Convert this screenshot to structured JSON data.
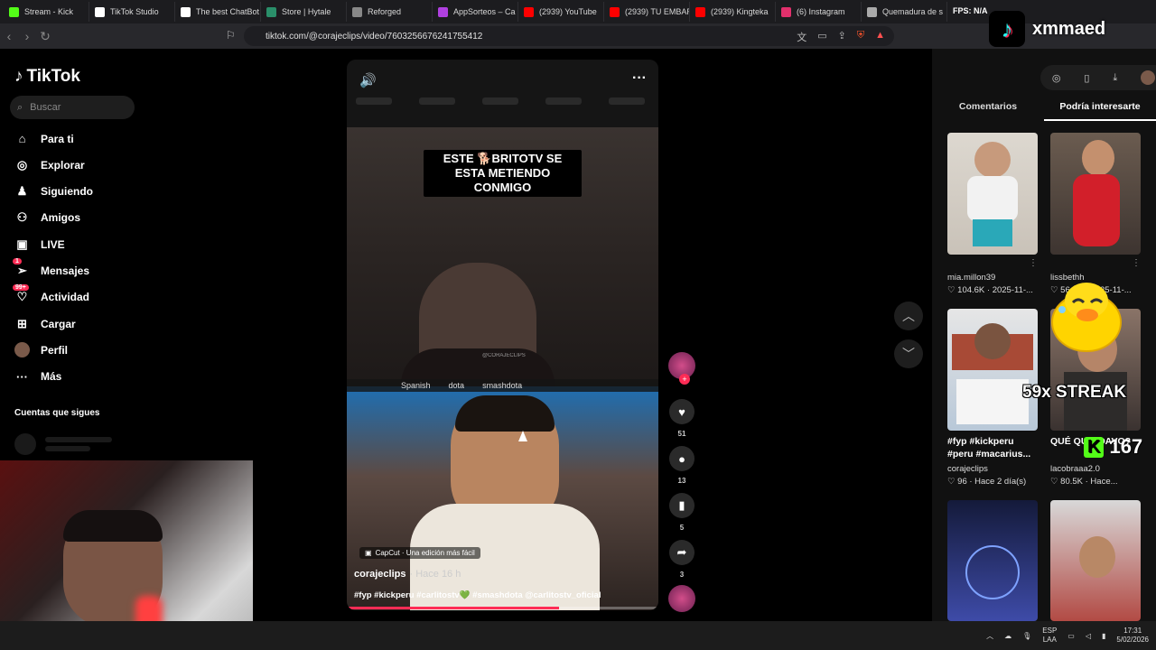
{
  "browser": {
    "tabs": [
      {
        "title": "Stream - Kick",
        "color": "#53fc18"
      },
      {
        "title": "TikTok Studio",
        "color": "#ffffff"
      },
      {
        "title": "The best ChatBot",
        "color": "#ffffff"
      },
      {
        "title": "Store | Hytale",
        "color": "#2a8f6a"
      },
      {
        "title": "Reforged",
        "color": "#888888"
      },
      {
        "title": "AppSorteos – Ca",
        "color": "#b040e0"
      },
      {
        "title": "(2939) YouTube",
        "color": "#ff0000"
      },
      {
        "title": "(2939) TU EMBAR",
        "color": "#ff0000"
      },
      {
        "title": "(2939) Kingteka",
        "color": "#ff0000"
      },
      {
        "title": "(6) Instagram",
        "color": "#e1306c"
      },
      {
        "title": "Quemadura de s",
        "color": "#aaaaaa"
      }
    ],
    "url": "tiktok.com/@corajeclips/video/7603256676241755412",
    "overlay_text": "FPS: N/A"
  },
  "sidebar": {
    "logo": "TikTok",
    "search_placeholder": "Buscar",
    "items": [
      {
        "label": "Para ti",
        "icon": "home-icon",
        "glyph": "⌂"
      },
      {
        "label": "Explorar",
        "icon": "compass-icon",
        "glyph": "◎"
      },
      {
        "label": "Siguiendo",
        "icon": "following-icon",
        "glyph": "♟"
      },
      {
        "label": "Amigos",
        "icon": "friends-icon",
        "glyph": "⚇"
      },
      {
        "label": "LIVE",
        "icon": "live-icon",
        "glyph": "▣"
      },
      {
        "label": "Mensajes",
        "icon": "messages-icon",
        "glyph": "➢",
        "badge": "1"
      },
      {
        "label": "Actividad",
        "icon": "activity-icon",
        "glyph": "♡",
        "badge": "99+"
      },
      {
        "label": "Cargar",
        "icon": "upload-icon",
        "glyph": "⊞"
      },
      {
        "label": "Perfil",
        "icon": "profile-icon",
        "glyph": "●"
      },
      {
        "label": "Más",
        "icon": "more-icon",
        "glyph": "···"
      }
    ],
    "following_header": "Cuentas que sigues"
  },
  "video": {
    "caption_overlay": "ESTE 🐕BRITOTV SE ESTA METIENDO CONMIGO",
    "watermark": "@CORAJECLIPS",
    "spanish_bar": [
      "Spanish",
      "dota",
      "smashdota"
    ],
    "capcut": "CapCut · Una edición más fácil",
    "author": "corajeclips",
    "time": "· Hace 16 h",
    "tags": "#fyp #kickperu #carlitostv💚 #smashdota @carlitostv_oficial",
    "progress": 0.68
  },
  "actions": {
    "likes": "51",
    "comments": "13",
    "saves": "5",
    "shares": "3"
  },
  "panel": {
    "tabs": [
      "Comentarios",
      "Podría interesarte"
    ],
    "active_tab": 1,
    "items": [
      {
        "user": "mia.millon39",
        "stats": "♡ 104.6K · 2025-11-..."
      },
      {
        "user": "lissbethh",
        "stats": "♡ 56.7K · 2025-11-..."
      },
      {
        "title": "#fyp #kickperu #peru #macarius...",
        "user": "corajeclips",
        "stats": "♡ 96 · Hace 2 día(s)"
      },
      {
        "title": "QUÉ QU... DAVO?",
        "user": "lacobraaa2.0",
        "stats": "♡ 80.5K · Hace..."
      }
    ]
  },
  "overlay": {
    "brand": "xmmaed",
    "streak": "59x STREAK",
    "kick_count": "167"
  },
  "taskbar": {
    "lang": "ESP",
    "lang2": "LAA",
    "time": "17:31",
    "date": "5/02/2026"
  }
}
